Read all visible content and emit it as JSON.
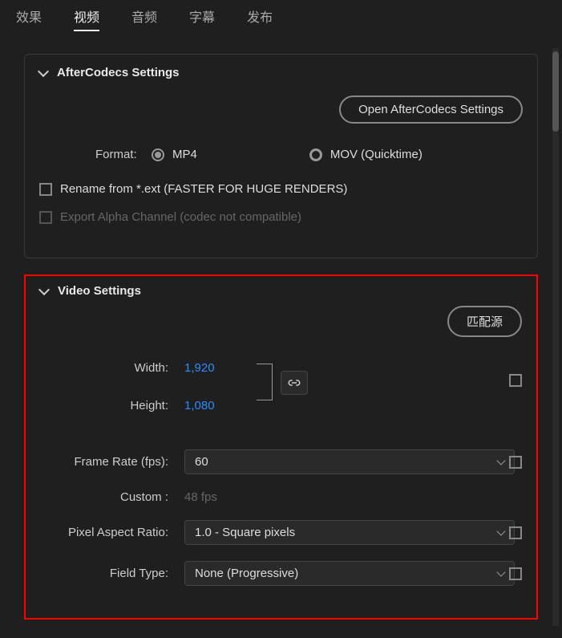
{
  "tabs": {
    "effects": "效果",
    "video": "视频",
    "audio": "音频",
    "captions": "字幕",
    "publish": "发布"
  },
  "aftercodecs": {
    "title": "AfterCodecs Settings",
    "open_button": "Open AfterCodecs Settings",
    "format_label": "Format:",
    "mp4": "MP4",
    "mov": "MOV (Quicktime)",
    "rename_label": "Rename from *.ext (FASTER FOR HUGE RENDERS)",
    "alpha_label": "Export Alpha Channel (codec not compatible)"
  },
  "video": {
    "title": "Video Settings",
    "match_source": "匹配源",
    "width_label": "Width:",
    "width_val": "1,920",
    "height_label": "Height:",
    "height_val": "1,080",
    "framerate_label": "Frame Rate (fps):",
    "framerate_val": "60",
    "custom_label": "Custom :",
    "custom_val": "48  fps",
    "par_label": "Pixel Aspect Ratio:",
    "par_val": "1.0 - Square pixels",
    "fieldtype_label": "Field Type:",
    "fieldtype_val": "None (Progressive)"
  }
}
